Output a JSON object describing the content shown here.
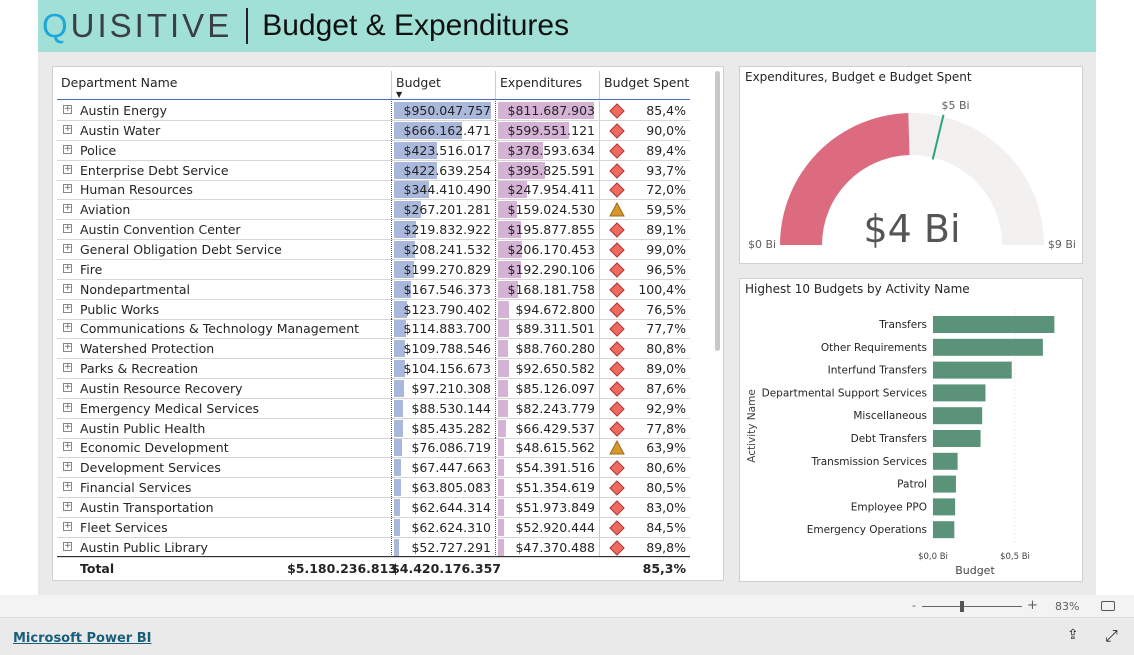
{
  "header": {
    "logo": "QUISITIVE",
    "title": "Budget & Expenditures"
  },
  "table": {
    "columns": [
      "Department Name",
      "Budget",
      "Expenditures",
      "Budget Spent"
    ],
    "sort_indicator": "sort-descending-icon",
    "rows": [
      [
        "Austin Energy",
        "$950.047.757",
        "$811.687.903",
        "diamond",
        "85,4%"
      ],
      [
        "Austin Water",
        "$666.162.471",
        "$599.551.121",
        "diamond",
        "90,0%"
      ],
      [
        "Police",
        "$423.516.017",
        "$378.593.634",
        "diamond",
        "89,4%"
      ],
      [
        "Enterprise Debt Service",
        "$422.639.254",
        "$395.825.591",
        "diamond",
        "93,7%"
      ],
      [
        "Human Resources",
        "$344.410.490",
        "$247.954.411",
        "diamond",
        "72,0%"
      ],
      [
        "Aviation",
        "$267.201.281",
        "$159.024.530",
        "triangle",
        "59,5%"
      ],
      [
        "Austin Convention Center",
        "$219.832.922",
        "$195.877.855",
        "diamond",
        "89,1%"
      ],
      [
        "General Obligation Debt Service",
        "$208.241.532",
        "$206.170.453",
        "diamond",
        "99,0%"
      ],
      [
        "Fire",
        "$199.270.829",
        "$192.290.106",
        "diamond",
        "96,5%"
      ],
      [
        "Nondepartmental",
        "$167.546.373",
        "$168.181.758",
        "diamond",
        "100,4%"
      ],
      [
        "Public Works",
        "$123.790.402",
        "$94.672.800",
        "diamond",
        "76,5%"
      ],
      [
        "Communications & Technology Management",
        "$114.883.700",
        "$89.311.501",
        "diamond",
        "77,7%"
      ],
      [
        "Watershed Protection",
        "$109.788.546",
        "$88.760.280",
        "diamond",
        "80,8%"
      ],
      [
        "Parks & Recreation",
        "$104.156.673",
        "$92.650.582",
        "diamond",
        "89,0%"
      ],
      [
        "Austin Resource Recovery",
        "$97.210.308",
        "$85.126.097",
        "diamond",
        "87,6%"
      ],
      [
        "Emergency Medical Services",
        "$88.530.144",
        "$82.243.779",
        "diamond",
        "92,9%"
      ],
      [
        "Austin Public Health",
        "$85.435.282",
        "$66.429.537",
        "diamond",
        "77,8%"
      ],
      [
        "Economic Development",
        "$76.086.719",
        "$48.615.562",
        "triangle",
        "63,9%"
      ],
      [
        "Development Services",
        "$67.447.663",
        "$54.391.516",
        "diamond",
        "80,6%"
      ],
      [
        "Financial Services",
        "$63.805.083",
        "$51.354.619",
        "diamond",
        "80,5%"
      ],
      [
        "Austin Transportation",
        "$62.644.314",
        "$51.973.849",
        "diamond",
        "83,0%"
      ],
      [
        "Fleet Services",
        "$62.624.310",
        "$52.920.444",
        "diamond",
        "84,5%"
      ],
      [
        "Austin Public Library",
        "$52.727.291",
        "$47.370.488",
        "diamond",
        "89,8%"
      ]
    ],
    "total": [
      "Total",
      "$5.180.236.813",
      "$4.420.176.357",
      "85,3%"
    ],
    "colors": {
      "budget_bar": "#aab8dc",
      "exp_bar": "#d5b3d5",
      "diamond": "#f0695e",
      "triangle": "#d9962a"
    }
  },
  "chart_data": [
    {
      "type": "gauge",
      "title": "Expenditures, Budget e Budget Spent",
      "value": 4.42,
      "value_label": "$4 Bi",
      "min": 0,
      "min_label": "$0 Bi",
      "max": 9,
      "max_label": "$9 Bi",
      "target": 5.18,
      "target_label": "$5 Bi",
      "colors": {
        "fill": "#dd6b7f",
        "track": "#f2f1f0",
        "target": "#2aa57f"
      }
    },
    {
      "type": "bar",
      "orientation": "horizontal",
      "title": "Highest 10 Budgets by Activity Name",
      "xlabel": "Budget",
      "ylabel": "Activity Name",
      "categories": [
        "Transfers",
        "Other Requirements",
        "Interfund Transfers",
        "Departmental Support Services",
        "Miscellaneous",
        "Debt Transfers",
        "Transmission Services",
        "Patrol",
        "Employee PPO",
        "Emergency Operations"
      ],
      "values": [
        0.74,
        0.67,
        0.48,
        0.32,
        0.3,
        0.29,
        0.15,
        0.14,
        0.135,
        0.13
      ],
      "xticks": [
        0,
        0.5
      ],
      "xtick_labels": [
        "$0,0 Bi",
        "$0,5 Bi"
      ],
      "xlim": [
        0,
        0.77
      ],
      "grid": true,
      "color": "#5a937a"
    }
  ],
  "zoom": {
    "minus": "-",
    "plus": "+",
    "level": "83%",
    "level_fraction": 0.5
  },
  "footer": {
    "link": "Microsoft Power BI"
  }
}
